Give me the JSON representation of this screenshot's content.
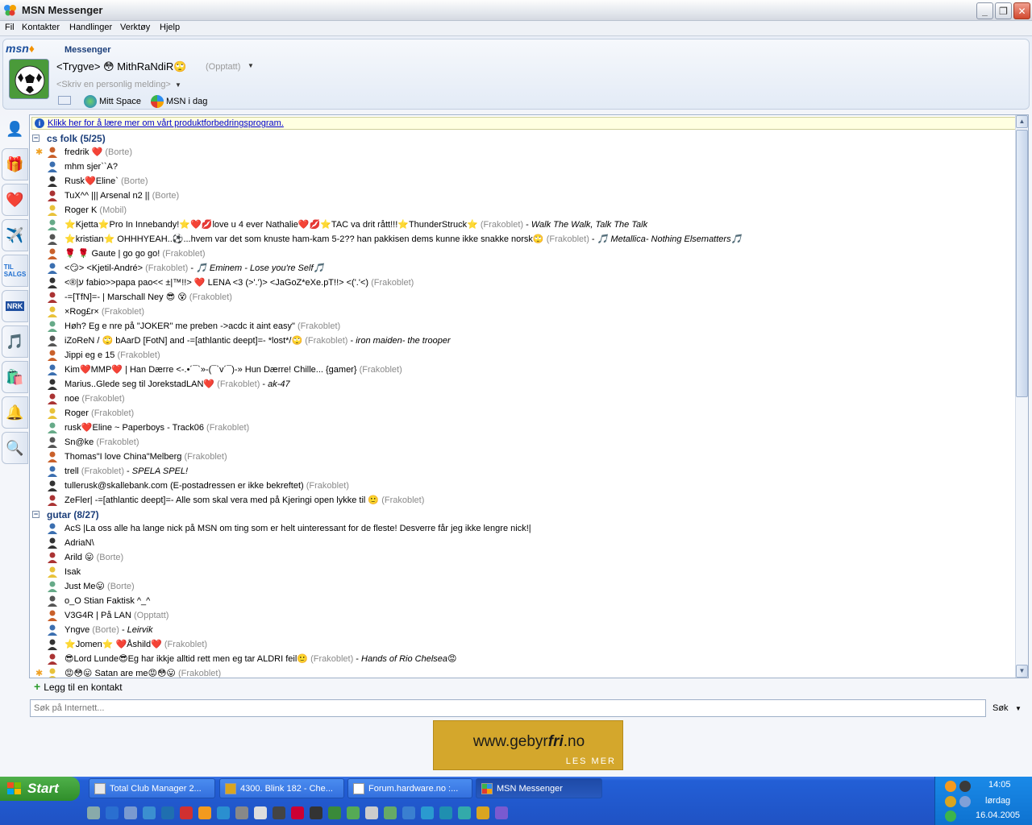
{
  "window": {
    "title": "MSN Messenger"
  },
  "menu": [
    "Fil",
    "Kontakter",
    "Handlinger",
    "Verktøy",
    "Hjelp"
  ],
  "header": {
    "brand_msn": "msn",
    "brand_messenger": "Messenger",
    "display_name": "<Trygve> 😳 MithRaNdiR🙄",
    "status": "(Opptatt)",
    "personal_message_placeholder": "<Skriv en personlig melding>",
    "mitt_space": "Mitt Space",
    "msn_i_dag": "MSN i dag"
  },
  "improve_link": "Klikk her for å lære mer om vårt produktforbedringsprogram.",
  "groups": [
    {
      "name": "cs folk (5/25)",
      "contacts": [
        {
          "name": "fredrik ❤️",
          "status": "(Borte)",
          "pm": "",
          "star": true
        },
        {
          "name": "mhm  sjer``A?",
          "status": "",
          "pm": "",
          "star": false
        },
        {
          "name": "Rusk❤️Eline`",
          "status": "(Borte)",
          "pm": "",
          "star": false
        },
        {
          "name": "TuX^^ ||| Arsenal n2 ||",
          "status": "(Borte)",
          "pm": "",
          "star": false
        },
        {
          "name": "Roger K",
          "status": "(Mobil)",
          "pm": "",
          "star": false
        },
        {
          "name": "⭐Kjetta⭐Pro In Innebandy!⭐❤️💋love u 4 ever Nathalie❤️💋⭐TAC va drit rått!!!⭐ThunderStruck⭐",
          "status": "(Frakoblet)",
          "pm": "Walk The Walk, Talk The Talk",
          "star": false
        },
        {
          "name": "⭐kristian⭐ OHHHYEAH..⚽...hvem var det som knuste ham-kam 5-2?? han pakkisen dems kunne ikke snakke norsk🙄",
          "status": "(Frakoblet)",
          "pm": "🎵 Metallica- Nothing Elsematters🎵",
          "star": false
        },
        {
          "name": "🌹 🌹 Gaute | go go go!",
          "status": "(Frakoblet)",
          "pm": "",
          "star": false
        },
        {
          "name": "<😏>  <Kjetil-André>",
          "status": "(Frakoblet)",
          "pm": "🎵 Eminem - Lose you're Self🎵",
          "star": false
        },
        {
          "name": "<®|ע fabio>>papa pao<< ±|™!!> ❤️ LENA <3  (>'.')>  <JaGoZ*eXe.pT!!> <('.'<)",
          "status": "(Frakoblet)",
          "pm": "",
          "star": false
        },
        {
          "name": "-=[TfN]=- | Marschall Ney 😎 😵",
          "status": "(Frakoblet)",
          "pm": "",
          "star": false
        },
        {
          "name": "×Rog£r×",
          "status": "(Frakoblet)",
          "pm": "",
          "star": false
        },
        {
          "name": "Høh?   Eg e nre på  \"JOKER\" me preben ->acdc it aint easy\"",
          "status": "(Frakoblet)",
          "pm": "",
          "star": false
        },
        {
          "name": "iZoReN  / 🙄 bAarD [FotN] and   -=[athlantic deept]=-  *lost*/🙄",
          "status": "(Frakoblet)",
          "pm": "iron maiden- the trooper",
          "star": false
        },
        {
          "name": "Jippi eg e 15",
          "status": "(Frakoblet)",
          "pm": "",
          "star": false
        },
        {
          "name": "Kim❤️MMP❤️ | Han Dærre <-.•´¯`»-(¯`v´¯)-» Hun Dærre! Chille... {gamer}",
          "status": "(Frakoblet)",
          "pm": "",
          "star": false
        },
        {
          "name": "Marius..Glede seg til JorekstadLAN❤️",
          "status": "(Frakoblet)",
          "pm": "ak-47",
          "star": false
        },
        {
          "name": "noe",
          "status": "(Frakoblet)",
          "pm": "",
          "star": false
        },
        {
          "name": "Roger",
          "status": "(Frakoblet)",
          "pm": "",
          "star": false
        },
        {
          "name": "rusk❤️Eline ~ Paperboys - Track06",
          "status": "(Frakoblet)",
          "pm": "",
          "star": false
        },
        {
          "name": "Sn@ke",
          "status": "(Frakoblet)",
          "pm": "",
          "star": false
        },
        {
          "name": "Thomas\"I love China\"Melberg",
          "status": "(Frakoblet)",
          "pm": "",
          "star": false
        },
        {
          "name": "trell",
          "status": "(Frakoblet)",
          "pm": "SPELA SPEL!",
          "star": false
        },
        {
          "name": "tullerusk@skallebank.com (E-postadressen er ikke bekreftet)",
          "status": "(Frakoblet)",
          "pm": "",
          "star": false
        },
        {
          "name": "ZeFler|  -=[athlantic deept]=- Alle som skal vera med på Kjeringi open lykke til 🙂",
          "status": "(Frakoblet)",
          "pm": "",
          "star": false
        }
      ]
    },
    {
      "name": "gutar (8/27)",
      "contacts": [
        {
          "name": "AcS |La oss alle ha lange nick på MSN om ting som er helt uinteressant for de fleste! Desverre får jeg ikke lengre nick!|",
          "status": "",
          "pm": "",
          "star": false
        },
        {
          "name": "AdriaN\\",
          "status": "",
          "pm": "",
          "star": false
        },
        {
          "name": "Arild 😛",
          "status": "(Borte)",
          "pm": "",
          "star": false
        },
        {
          "name": "Isak",
          "status": "",
          "pm": "",
          "star": false
        },
        {
          "name": "Just Me😛",
          "status": "(Borte)",
          "pm": "",
          "star": false
        },
        {
          "name": "o_O Stian Faktisk ^_^",
          "status": "",
          "pm": "",
          "star": false
        },
        {
          "name": "V3G4R | På LAN",
          "status": "(Opptatt)",
          "pm": "",
          "star": false
        },
        {
          "name": "Yngve",
          "status": "(Borte)",
          "pm": "Leirvik",
          "star": false
        },
        {
          "name": "⭐Jomen⭐ ❤️Åshild❤️",
          "status": "(Frakoblet)",
          "pm": "",
          "star": false
        },
        {
          "name": "😎Lord Lunde😎Eg har ikkje alltid rett men eg tar ALDRI feil🙂",
          "status": "(Frakoblet)",
          "pm": "Hands of Rio Chelsea😡",
          "star": false
        },
        {
          "name": "😡😳😛 Satan are me😡😳😛",
          "status": "(Frakoblet)",
          "pm": "",
          "star": true
        }
      ]
    }
  ],
  "add_contact": "Legg til en kontakt",
  "search": {
    "placeholder": "Søk på Internett...",
    "button": "Søk"
  },
  "ad": {
    "domain_pre": "www.gebyr",
    "domain_bold": "fri",
    "domain_post": ".no",
    "cta": "LES MER"
  },
  "taskbar": {
    "start": "Start",
    "tasks": [
      "Total Club Manager 2...",
      "4300. Blink 182 - Che...",
      "Forum.hardware.no :...",
      "MSN Messenger"
    ],
    "time": "14:05",
    "day": "lørdag",
    "date": "16.04.2005"
  },
  "colors": {
    "group_title": "#1b3e7a",
    "status_grey": "#8a8a8a",
    "link_blue": "#0000cc"
  }
}
